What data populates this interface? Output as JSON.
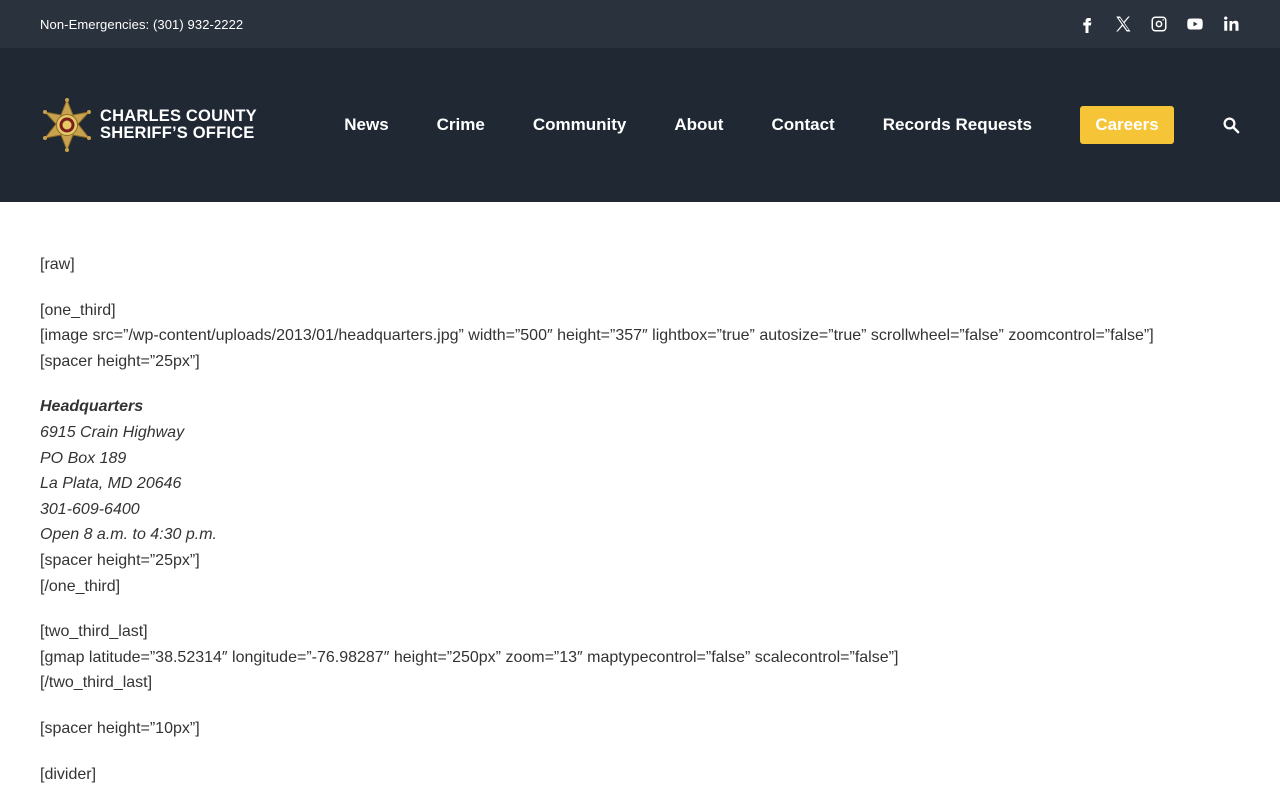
{
  "topbar": {
    "phone": "Non-Emergencies: (301) 932-2222",
    "social": [
      "facebook-icon",
      "x-icon",
      "instagram-icon",
      "youtube-icon",
      "linkedin-icon"
    ]
  },
  "header": {
    "logo_line1": "CHARLES COUNTY",
    "logo_line2": "SHERIFF’S OFFICE",
    "nav": [
      "News",
      "Crime",
      "Community",
      "About",
      "Contact",
      "Records Requests"
    ],
    "careers": "Careers",
    "accent": "#f6c537"
  },
  "content": {
    "raw": "[raw]",
    "one_third_open": "[one_third]",
    "image_code": "[image src=”/wp-content/uploads/2013/01/headquarters.jpg” width=”500″ height=”357″ lightbox=”true” autosize=”true” scrollwheel=”false” zoomcontrol=”false”]",
    "spacer25": "[spacer height=”25px”]",
    "hq_title": "Headquarters",
    "hq_address1": "6915 Crain Highway",
    "hq_address2": "PO Box 189",
    "hq_address3": "La Plata, MD 20646",
    "hq_phone": "301-609-6400",
    "hq_hours": "Open 8 a.m. to 4:30 p.m.",
    "spacer25b": "[spacer height=”25px”]",
    "one_third_close": "[/one_third]",
    "two_third_open": "[two_third_last]",
    "gmap_code": "[gmap latitude=”38.52314″ longitude=”-76.98287″ height=”250px” zoom=”13″ maptypecontrol=”false” scalecontrol=”false”]",
    "two_third_close": "[/two_third_last]",
    "spacer10": "[spacer height=”10px”]",
    "divider": "[divider]"
  }
}
